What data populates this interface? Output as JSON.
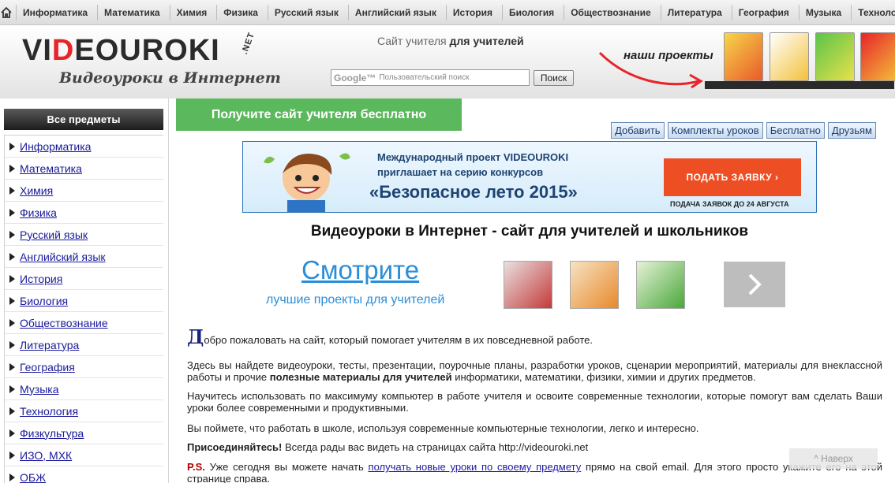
{
  "topnav": {
    "items": [
      "Информатика",
      "Математика",
      "Химия",
      "Физика",
      "Русский язык",
      "Английский язык",
      "История",
      "Биология",
      "Обществознание",
      "Литература",
      "География",
      "Музыка",
      "Технология"
    ]
  },
  "header": {
    "logo_pre": "VI",
    "logo_d": "D",
    "logo_post": "EOUROKI",
    "logo_net": ".NET",
    "tagline": "Видеоуроки в Интернет",
    "teacher_site_prefix": "Сайт учителя",
    "teacher_site_bold": "для учителей",
    "search_brand": "Google™",
    "search_placeholder": "Пользовательский поиск",
    "search_button": "Поиск",
    "projects_label": "наши проекты"
  },
  "sidebar": {
    "heading": "Все предметы",
    "items": [
      "Информатика",
      "Математика",
      "Химия",
      "Физика",
      "Русский язык",
      "Английский язык",
      "История",
      "Биология",
      "Обществознание",
      "Литература",
      "География",
      "Музыка",
      "Технология",
      "Физкультура",
      "ИЗО, МХК",
      "ОБЖ"
    ]
  },
  "main": {
    "green_button": "Получите сайт учителя бесплатно",
    "tabs": [
      "Добавить",
      "Комплекты уроков",
      "Бесплатно",
      "Друзьям"
    ],
    "banner": {
      "line1_prefix": "Международный проект",
      "line1_brand": "VIDEOUROKI",
      "line2": "приглашает на серию конкурсов",
      "line3": "«Безопасное лето 2015»",
      "cta": "ПОДАТЬ ЗАЯВКУ  ›",
      "deadline": "ПОДАЧА ЗАЯВОК ДО 24 АВГУСТА"
    },
    "title": "Видеоуроки в Интернет - сайт для учителей и школьников",
    "watch": "Смотрите",
    "watch_sub": "лучшие проекты для учителей",
    "p1_initial": "Д",
    "p1_rest": "обро пожаловать на сайт, который помогает учителям в их повседневной работе.",
    "p2_a": "Здесь вы найдете видеоуроки, тесты, презентации, поурочные планы, разработки уроков, сценарии мероприятий, материалы для внеклассной работы и  прочие ",
    "p2_bold": "полезные материалы для учителей",
    "p2_b": " информатики, математики, физики, химии и других предметов.",
    "p3": "Научитесь использовать по максимуму компьютер в работе учителя и освоите современные технологии, которые помогут вам сделать Ваши уроки более современными и продуктивными.",
    "p4": "Вы поймете, что работать в школе, используя современные компьютерные технологии, легко и интересно.",
    "p5_bold": "Присоединяйтесь!",
    "p5_rest": " Всегда рады вас видеть на страницах сайта http://videouroki.net",
    "p6_red": "P.S.",
    "p6_a": " Уже сегодня вы можете начать ",
    "p6_link": "получать новые уроки по своему предмету",
    "p6_b": " прямо на свой email. Для этого просто укажите его на этой странице справа.",
    "back_to_top": "^ Наверх"
  },
  "colors": {
    "green": "#5cb85c",
    "cta_orange": "#ee4e24",
    "link_blue": "#2b8ed8",
    "logo_red": "#e8242a"
  }
}
